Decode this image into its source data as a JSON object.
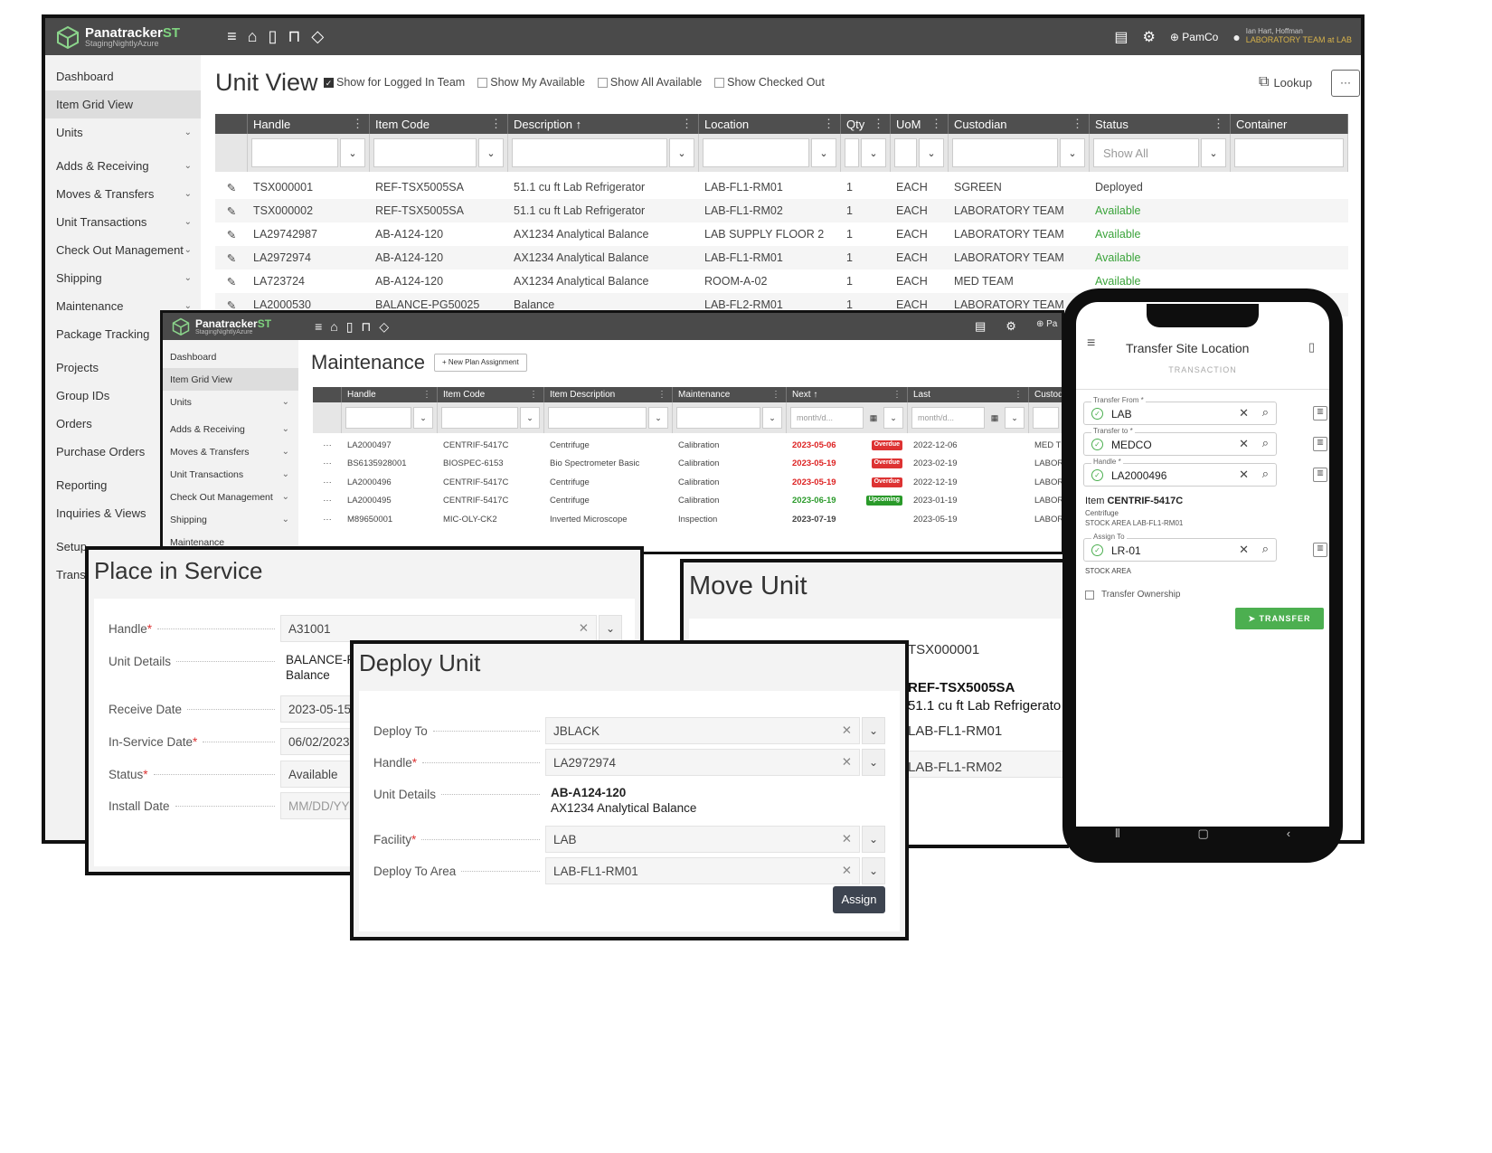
{
  "main": {
    "app_name": "Panatracker",
    "app_name_accent": "ST",
    "app_sub": "StagingNightlyAzure",
    "user_org": "PamCo",
    "user_name": "Ian Hart, Hoffman",
    "user_team": "LABORATORY TEAM at LAB",
    "sidebar": [
      "Dashboard",
      "Item Grid View",
      "Units",
      "Adds & Receiving",
      "Moves & Transfers",
      "Unit Transactions",
      "Check Out Management",
      "Shipping",
      "Maintenance",
      "Package Tracking",
      "Projects",
      "Group IDs",
      "Orders",
      "Purchase Orders",
      "Reporting",
      "Inquiries & Views",
      "Setup",
      "Transa"
    ],
    "page_title": "Unit View",
    "checkboxes": [
      "Show for Logged In Team",
      "Show My Available",
      "Show All Available",
      "Show Checked Out"
    ],
    "lookup": "Lookup",
    "more": "···",
    "columns": [
      "Handle",
      "Item Code",
      "Description ↑",
      "Location",
      "Qty",
      "UoM",
      "Custodian",
      "Status",
      "Container"
    ],
    "status_filter": "Show All",
    "rows": [
      [
        "TSX000001",
        "REF-TSX5005SA",
        "51.1 cu ft Lab Refrigerator",
        "LAB-FL1-RM01",
        "1",
        "EACH",
        "SGREEN",
        "Deployed"
      ],
      [
        "TSX000002",
        "REF-TSX5005SA",
        "51.1 cu ft Lab Refrigerator",
        "LAB-FL1-RM02",
        "1",
        "EACH",
        "LABORATORY TEAM",
        "Available"
      ],
      [
        "LA29742987",
        "AB-A124-120",
        "AX1234 Analytical Balance",
        "LAB SUPPLY FLOOR 2",
        "1",
        "EACH",
        "LABORATORY TEAM",
        "Available"
      ],
      [
        "LA2972974",
        "AB-A124-120",
        "AX1234 Analytical Balance",
        "LAB-FL1-RM01",
        "1",
        "EACH",
        "LABORATORY TEAM",
        "Available"
      ],
      [
        "LA723724",
        "AB-A124-120",
        "AX1234 Analytical Balance",
        "ROOM-A-02",
        "1",
        "EACH",
        "MED TEAM",
        "Available"
      ],
      [
        "LA2000530",
        "BALANCE-PG50025",
        "Balance",
        "LAB-FL2-RM01",
        "1",
        "EACH",
        "LABORATORY TEAM",
        ""
      ]
    ]
  },
  "maint": {
    "app_name": "Panatracker",
    "app_name_accent": "ST",
    "app_sub": "StagingNightlyAzure",
    "org": "Pa",
    "sidebar": [
      "Dashboard",
      "Item Grid View",
      "Units",
      "Adds & Receiving",
      "Moves & Transfers",
      "Unit Transactions",
      "Check Out Management",
      "Shipping",
      "Maintenance"
    ],
    "title": "Maintenance",
    "new_plan": "+ New Plan Assignment",
    "columns": [
      "Handle",
      "Item Code",
      "Item Description",
      "Maintenance",
      "Next ↑",
      "Last",
      "Custod"
    ],
    "date_placeholder": "month/d...",
    "rows": [
      [
        "LA2000497",
        "CENTRIF-5417C",
        "Centrifuge",
        "Calibration",
        "2023-05-06",
        "Overdue",
        "2022-12-06",
        "MED T"
      ],
      [
        "BS6135928001",
        "BIOSPEC-6153",
        "Bio Spectrometer Basic",
        "Calibration",
        "2023-05-19",
        "Overdue",
        "2023-02-19",
        "LABOR"
      ],
      [
        "LA2000496",
        "CENTRIF-5417C",
        "Centrifuge",
        "Calibration",
        "2023-05-19",
        "Overdue",
        "2022-12-19",
        "LABOR"
      ],
      [
        "LA2000495",
        "CENTRIF-5417C",
        "Centrifuge",
        "Calibration",
        "2023-06-19",
        "Upcoming",
        "2023-01-19",
        "LABOR"
      ],
      [
        "M89650001",
        "MIC-OLY-CK2",
        "Inverted Microscope",
        "Inspection",
        "2023-07-19",
        "",
        "2023-05-19",
        "LABOR"
      ]
    ]
  },
  "place": {
    "title": "Place in Service",
    "fields": [
      {
        "label": "Handle",
        "req": "*",
        "value": "A31001"
      },
      {
        "label": "Unit Details",
        "req": "",
        "value": "BALANCE-P",
        "value2": "Balance"
      },
      {
        "label": "Receive Date",
        "req": "",
        "value": "2023-05-15"
      },
      {
        "label": "In-Service Date",
        "req": "*",
        "value": "06/02/2023"
      },
      {
        "label": "Status",
        "req": "*",
        "value": "Available"
      },
      {
        "label": "Install Date",
        "req": "",
        "value": "MM/DD/YY"
      }
    ]
  },
  "move": {
    "title": "Move Unit",
    "lines": [
      "TSX000001",
      "REF-TSX5005SA",
      "51.1 cu ft Lab Refrigerato",
      "LAB-FL1-RM01",
      "LAB-FL1-RM02"
    ]
  },
  "deploy": {
    "title": "Deploy Unit",
    "fields": [
      {
        "label": "Deploy To",
        "req": "",
        "value": "JBLACK"
      },
      {
        "label": "Handle",
        "req": "*",
        "value": "LA2972974"
      },
      {
        "label": "Unit Details",
        "req": "",
        "value": "AB-A124-120",
        "value2": "AX1234 Analytical Balance"
      },
      {
        "label": "Facility",
        "req": "*",
        "value": "LAB"
      },
      {
        "label": "Deploy To Area",
        "req": "",
        "value": "LAB-FL1-RM01"
      }
    ],
    "assign": "Assign"
  },
  "mobile": {
    "title": "Transfer Site Location",
    "subtitle": "TRANSACTION",
    "from_label": "Transfer From *",
    "from": "LAB",
    "to_label": "Transfer to *",
    "to": "MEDCO",
    "handle_label": "Handle *",
    "handle": "LA2000496",
    "item_label": "Item",
    "item": "CENTRIF-5417C",
    "item_desc": "Centrifuge",
    "item_loc": "STOCK AREA LAB-FL1-RM01",
    "assign_label": "Assign To",
    "assign": "LR-01",
    "area": "STOCK AREA",
    "ownership": "Transfer Ownership",
    "transfer": "TRANSFER"
  }
}
